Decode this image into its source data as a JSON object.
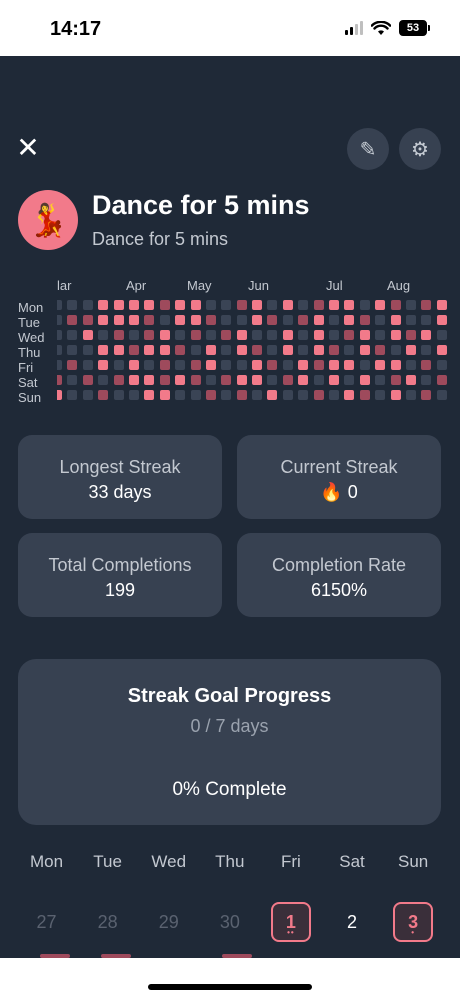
{
  "status_bar": {
    "time": "14:17",
    "battery": "53"
  },
  "header": {
    "title": "Dance for 5 mins",
    "subtitle": "Dance for 5 mins",
    "avatar_emoji": "💃",
    "edit_icon": "✎",
    "settings_icon": "⚙",
    "close_icon": "✕"
  },
  "heatmap": {
    "months": [
      "lar",
      "Apr",
      "May",
      "Jun",
      "Jul",
      "Aug"
    ],
    "days": [
      "Mon",
      "Tue",
      "Wed",
      "Thu",
      "Fri",
      "Sat",
      "Sun"
    ],
    "colors": {
      "empty": "#3a4455",
      "partial": "#9e4a5c",
      "complete": "#f27a8a"
    },
    "levels": [
      [
        0,
        0,
        0,
        0,
        0,
        1,
        2
      ],
      [
        0,
        1,
        0,
        0,
        1,
        0,
        0
      ],
      [
        0,
        1,
        2,
        0,
        0,
        1,
        0
      ],
      [
        2,
        2,
        0,
        2,
        2,
        0,
        1
      ],
      [
        2,
        2,
        1,
        2,
        0,
        1,
        0
      ],
      [
        2,
        2,
        0,
        1,
        2,
        2,
        0
      ],
      [
        2,
        1,
        1,
        2,
        0,
        2,
        2
      ],
      [
        1,
        0,
        2,
        2,
        1,
        1,
        2
      ],
      [
        2,
        2,
        0,
        1,
        0,
        2,
        0
      ],
      [
        2,
        2,
        1,
        0,
        1,
        1,
        0
      ],
      [
        0,
        1,
        0,
        2,
        2,
        0,
        1
      ],
      [
        0,
        0,
        1,
        0,
        0,
        1,
        0
      ],
      [
        1,
        0,
        2,
        2,
        0,
        2,
        1
      ],
      [
        2,
        2,
        0,
        1,
        2,
        2,
        0
      ],
      [
        0,
        1,
        0,
        0,
        1,
        0,
        2
      ],
      [
        2,
        0,
        2,
        2,
        0,
        1,
        0
      ],
      [
        0,
        1,
        0,
        0,
        2,
        2,
        0
      ],
      [
        1,
        2,
        2,
        2,
        1,
        0,
        1
      ],
      [
        2,
        0,
        0,
        1,
        2,
        2,
        0
      ],
      [
        2,
        2,
        1,
        0,
        2,
        0,
        2
      ],
      [
        0,
        1,
        2,
        2,
        0,
        2,
        1
      ],
      [
        2,
        0,
        0,
        1,
        2,
        0,
        0
      ],
      [
        1,
        2,
        2,
        0,
        2,
        1,
        2
      ],
      [
        0,
        0,
        1,
        2,
        0,
        2,
        0
      ],
      [
        1,
        0,
        2,
        0,
        1,
        0,
        1
      ],
      [
        2,
        2,
        0,
        2,
        0,
        1,
        0
      ]
    ]
  },
  "stats": {
    "longest": {
      "label": "Longest Streak",
      "value": "33 days"
    },
    "current": {
      "label": "Current Streak",
      "value": "🔥 0"
    },
    "total": {
      "label": "Total Completions",
      "value": "199"
    },
    "rate": {
      "label": "Completion Rate",
      "value": "6150%"
    }
  },
  "goal": {
    "title": "Streak Goal Progress",
    "progress": "0 / 7 days",
    "percent": "0% Complete",
    "completed_fraction": 0
  },
  "week": {
    "days": [
      "Mon",
      "Tue",
      "Wed",
      "Thu",
      "Fri",
      "Sat",
      "Sun"
    ],
    "dates": [
      {
        "num": "27",
        "state": "muted",
        "dots": ""
      },
      {
        "num": "28",
        "state": "muted",
        "dots": ""
      },
      {
        "num": "29",
        "state": "muted",
        "dots": ""
      },
      {
        "num": "30",
        "state": "muted",
        "dots": ""
      },
      {
        "num": "1",
        "state": "done",
        "dots": "••"
      },
      {
        "num": "2",
        "state": "normal",
        "dots": ""
      },
      {
        "num": "3",
        "state": "done",
        "dots": "•"
      }
    ]
  }
}
